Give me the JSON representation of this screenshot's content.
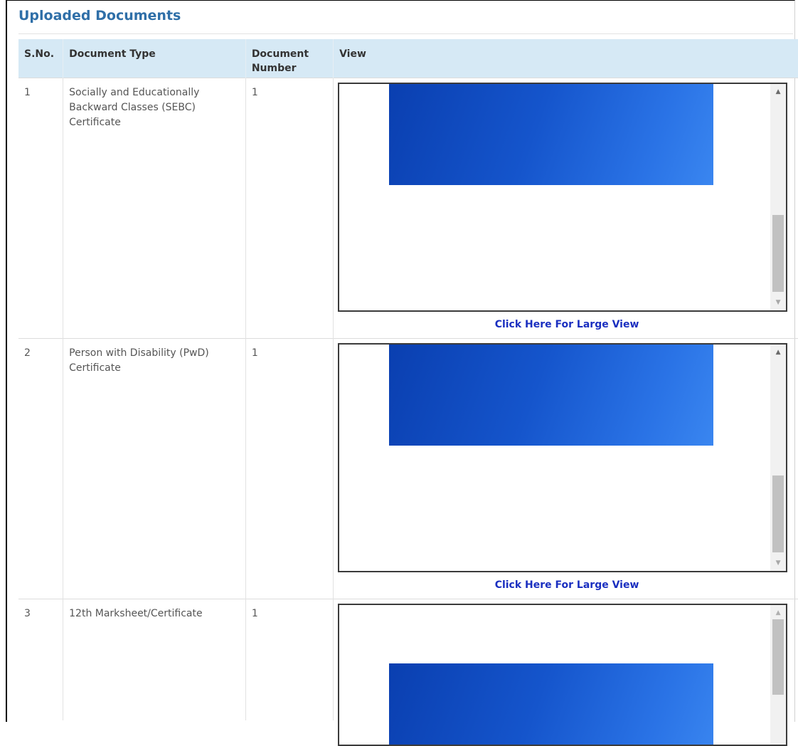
{
  "section": {
    "title": "Uploaded Documents"
  },
  "table": {
    "headers": {
      "sno": "S.No.",
      "doc_type": "Document Type",
      "doc_number": "Document Number",
      "view": "View"
    },
    "rows": [
      {
        "sno": "1",
        "doc_type": "Socially and Educationally Backward Classes (SEBC) Certificate",
        "doc_number": "1",
        "link": "Click Here For Large View"
      },
      {
        "sno": "2",
        "doc_type": "Person with Disability (PwD) Certificate",
        "doc_number": "1",
        "link": "Click Here For Large View"
      },
      {
        "sno": "3",
        "doc_type": "12th Marksheet/Certificate",
        "doc_number": "1",
        "link": ""
      }
    ]
  },
  "icons": {
    "scroll_up": "arrow-up-icon",
    "scroll_down": "arrow-down-icon"
  },
  "colors": {
    "header_bg": "#d6e9f5",
    "title": "#2f6fa8",
    "link": "#1a2fc0"
  }
}
